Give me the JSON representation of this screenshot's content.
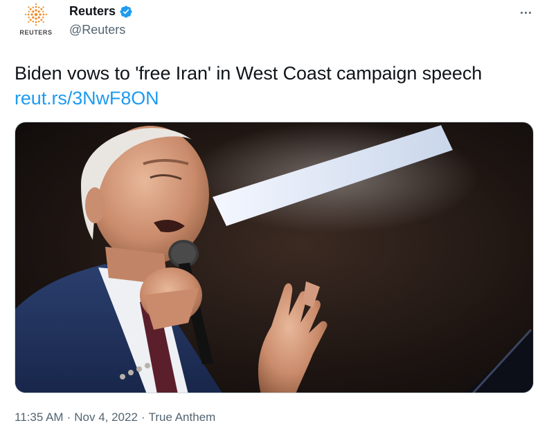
{
  "account": {
    "display_name": "Reuters",
    "handle": "@Reuters",
    "avatar_word": "REUTERS",
    "verified": true
  },
  "tweet": {
    "text": "Biden vows to 'free Iran' in West Coast campaign speech ",
    "link": "reut.rs/3NwF8ON"
  },
  "media": {
    "alt": "Photo of Joe Biden speaking into a microphone"
  },
  "meta": {
    "time": "11:35 AM",
    "date": "Nov 4, 2022",
    "source": "True Anthem",
    "separator": "·"
  },
  "colors": {
    "link": "#1d9bf0",
    "verified": "#1d9bf0",
    "secondary_text": "#536471",
    "reuters_orange": "#f08a24"
  },
  "icons": [
    "reuters-logo-icon",
    "verified-badge-icon",
    "more-options-icon"
  ]
}
